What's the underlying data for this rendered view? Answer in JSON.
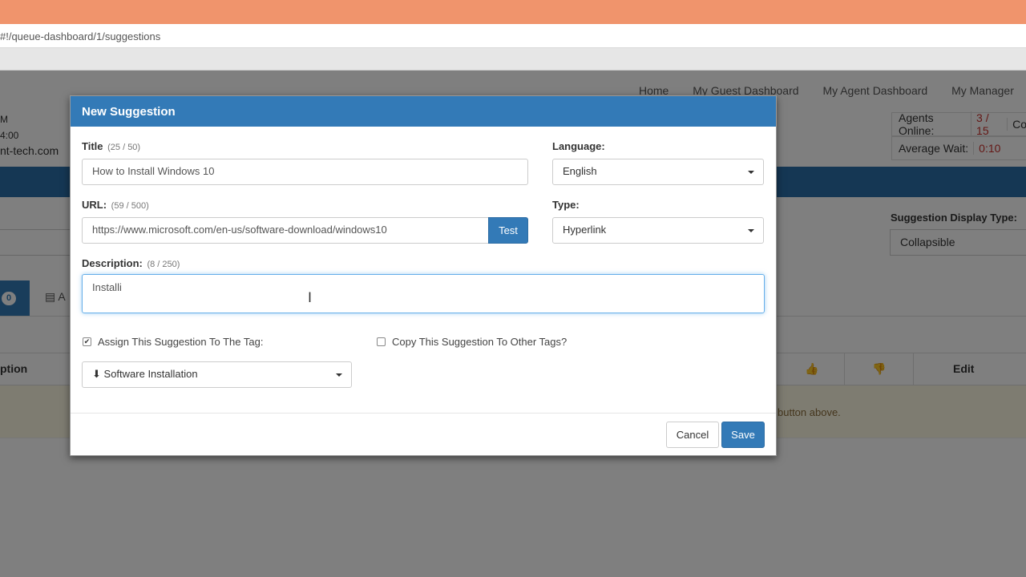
{
  "browser": {
    "url": "#!/queue-dashboard/1/suggestions"
  },
  "background": {
    "nav": [
      "Home",
      "My Guest Dashboard",
      "My Agent Dashboard",
      "My Manager Ho"
    ],
    "left_fragments": [
      "M",
      "4:00",
      "nt-tech.com"
    ],
    "stats": [
      {
        "label": "Agents Online:",
        "value": "3 / 15",
        "extra": "Co"
      },
      {
        "label": "Average Wait:",
        "value": "0:10"
      }
    ],
    "display_type_label": "Suggestion Display Type:",
    "display_type_value": "Collapsible",
    "badge_count": "0",
    "tab_fragment": "A",
    "table_headers": {
      "description": "ption",
      "edit": "Edit"
    },
    "warning_text": "button above."
  },
  "modal": {
    "title": "New Suggestion",
    "title_label": "Title",
    "title_count": "(25 / 50)",
    "title_value": "How to Install Windows 10",
    "language_label": "Language:",
    "language_value": "English",
    "url_label": "URL:",
    "url_count": "(59 / 500)",
    "url_value": "https://www.microsoft.com/en-us/software-download/windows10",
    "test_button": "Test",
    "type_label": "Type:",
    "type_value": "Hyperlink",
    "description_label": "Description:",
    "description_count": "(8 / 250)",
    "description_value": "Installi",
    "assign_label": "Assign This Suggestion To The Tag:",
    "assign_checked": true,
    "copy_label": "Copy This Suggestion To Other Tags?",
    "copy_checked": false,
    "tag_value": "Software Installation",
    "cancel_button": "Cancel",
    "save_button": "Save"
  },
  "colors": {
    "primary": "#337ab7",
    "titlebar": "#f0946c",
    "danger_text": "#c9302c"
  }
}
